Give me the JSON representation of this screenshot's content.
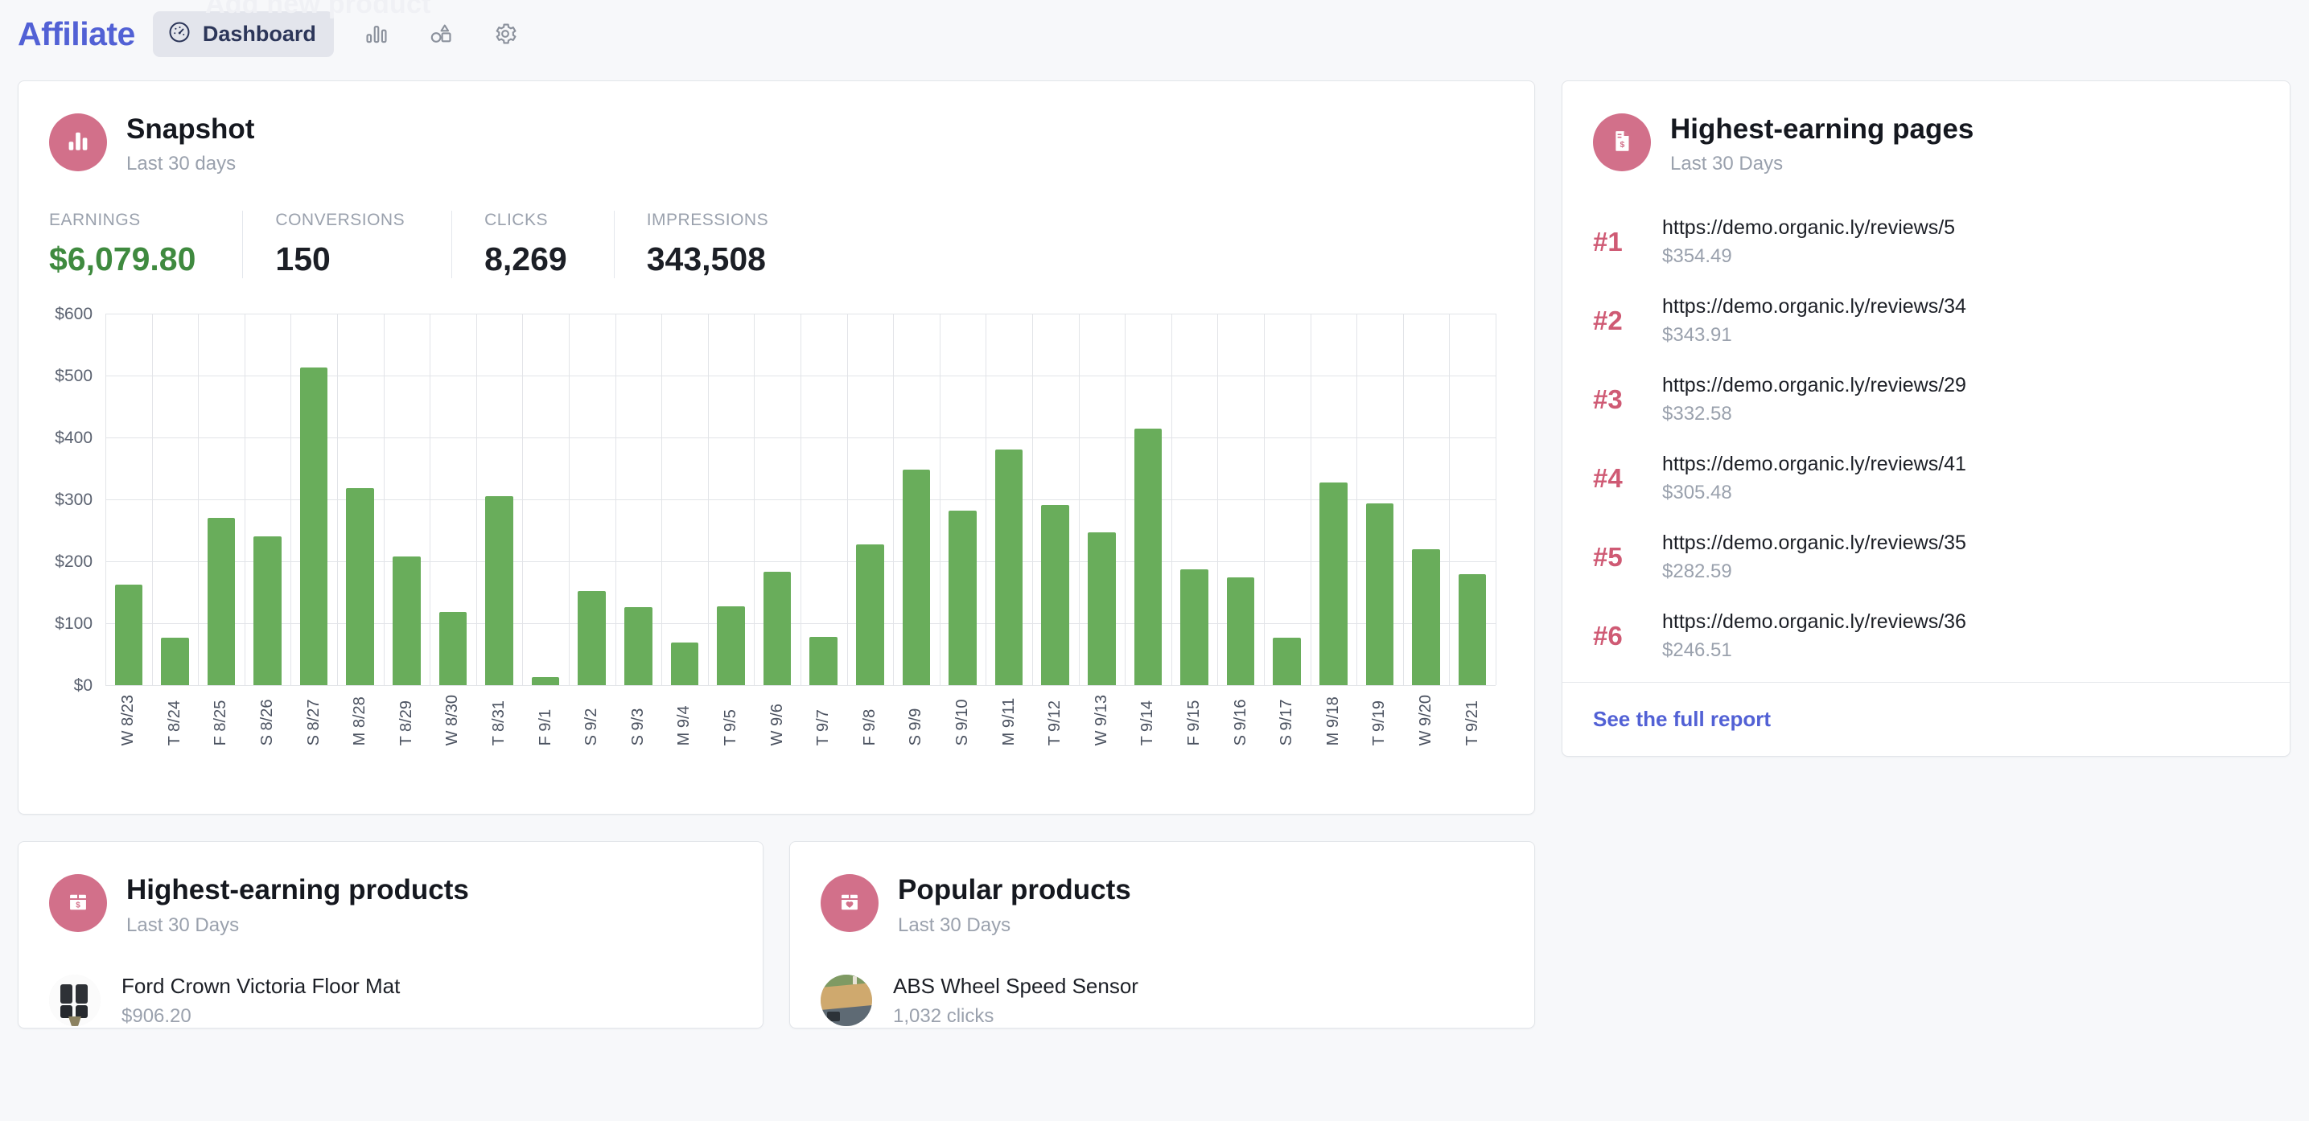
{
  "ghost_banner": "Add new product",
  "nav": {
    "brand": "Affiliate",
    "active_tab": "Dashboard",
    "icons": [
      {
        "name": "reports-bar-chart-icon",
        "label": "Reports"
      },
      {
        "name": "products-shapes-icon",
        "label": "Products"
      },
      {
        "name": "gear-icon",
        "label": "Settings"
      }
    ]
  },
  "snapshot": {
    "title": "Snapshot",
    "subtitle": "Last 30 days",
    "badge_icon": "bar-chart-icon",
    "metrics": [
      {
        "label": "EARNINGS",
        "value": "$6,079.80",
        "accent": "#3f8a3f"
      },
      {
        "label": "CONVERSIONS",
        "value": "150"
      },
      {
        "label": "CLICKS",
        "value": "8,269"
      },
      {
        "label": "IMPRESSIONS",
        "value": "343,508"
      }
    ]
  },
  "chart_data": {
    "type": "bar",
    "title": "Snapshot",
    "xlabel": "",
    "ylabel": "",
    "ylim": [
      0,
      600
    ],
    "yticks": [
      "$0",
      "$100",
      "$200",
      "$300",
      "$400",
      "$500",
      "$600"
    ],
    "ytick_values": [
      0,
      100,
      200,
      300,
      400,
      500,
      600
    ],
    "grid": true,
    "legend": "none",
    "bar_color": "#69ad5b",
    "categories": [
      "W 8/23",
      "T 8/24",
      "F 8/25",
      "S 8/26",
      "S 8/27",
      "M 8/28",
      "T 8/29",
      "W 8/30",
      "T 8/31",
      "F 9/1",
      "S 9/2",
      "S 9/3",
      "M 9/4",
      "T 9/5",
      "W 9/6",
      "T 9/7",
      "F 9/8",
      "S 9/9",
      "S 9/10",
      "M 9/11",
      "T 9/12",
      "W 9/13",
      "T 9/14",
      "F 9/15",
      "S 9/16",
      "S 9/17",
      "M 9/18",
      "T 9/19",
      "W 9/20",
      "T 9/21"
    ],
    "values": [
      163,
      77,
      270,
      241,
      513,
      318,
      208,
      119,
      306,
      13,
      152,
      126,
      69,
      128,
      184,
      78,
      228,
      348,
      282,
      381,
      291,
      247,
      414,
      188,
      175,
      77,
      327,
      294,
      220,
      180
    ]
  },
  "highest_earning_pages": {
    "title": "Highest-earning pages",
    "subtitle": "Last 30 Days",
    "badge_icon": "document-dollar-icon",
    "rows": [
      {
        "rank": "#1",
        "url": "https://demo.organic.ly/reviews/5",
        "amount": "$354.49"
      },
      {
        "rank": "#2",
        "url": "https://demo.organic.ly/reviews/34",
        "amount": "$343.91"
      },
      {
        "rank": "#3",
        "url": "https://demo.organic.ly/reviews/29",
        "amount": "$332.58"
      },
      {
        "rank": "#4",
        "url": "https://demo.organic.ly/reviews/41",
        "amount": "$305.48"
      },
      {
        "rank": "#5",
        "url": "https://demo.organic.ly/reviews/35",
        "amount": "$282.59"
      },
      {
        "rank": "#6",
        "url": "https://demo.organic.ly/reviews/36",
        "amount": "$246.51"
      }
    ],
    "footer_link": "See the full report"
  },
  "highest_earning_products": {
    "title": "Highest-earning products",
    "subtitle": "Last 30 Days",
    "badge_icon": "bag-dollar-icon",
    "rows": [
      {
        "name": "Ford Crown Victoria Floor Mat",
        "meta": "$906.20",
        "thumb": "floor-mat-photo"
      }
    ]
  },
  "popular_products": {
    "title": "Popular products",
    "subtitle": "Last 30 Days",
    "badge_icon": "bag-heart-icon",
    "rows": [
      {
        "name": "ABS Wheel Speed Sensor",
        "meta": "1,032 clicks",
        "thumb": "sensor-photo"
      }
    ]
  },
  "colors": {
    "brand": "#5261d5",
    "badge_pink": "#d2708a",
    "rank_pink": "#cf5a74",
    "bar_green": "#69ad5b",
    "earnings_green": "#3f8a3f",
    "page_bg": "#f7f8fa"
  }
}
